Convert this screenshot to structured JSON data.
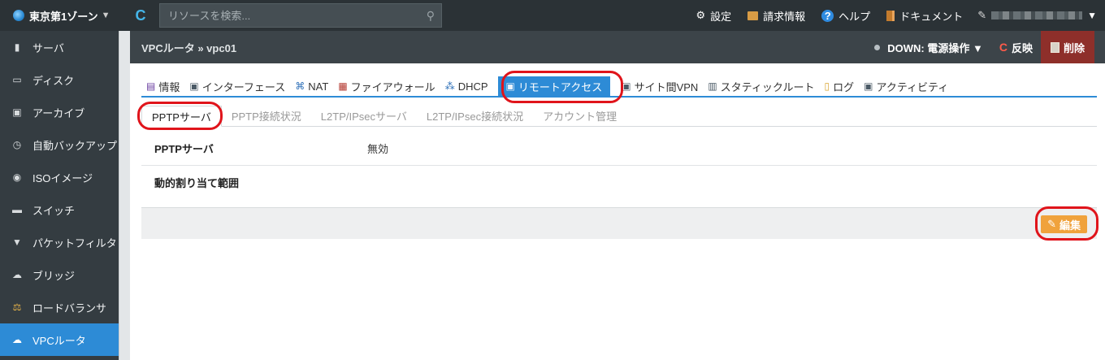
{
  "topbar": {
    "zone_label": "東京第1ゾーン",
    "search_placeholder": "リソースを検索...",
    "links": [
      {
        "label": "設定",
        "icon": "gear-icon"
      },
      {
        "label": "請求情報",
        "icon": "billing-icon"
      },
      {
        "label": "ヘルプ",
        "icon": "help-icon"
      },
      {
        "label": "ドキュメント",
        "icon": "document-icon"
      }
    ]
  },
  "sidebar": {
    "items": [
      {
        "label": "サーバ",
        "icon": "server-icon"
      },
      {
        "label": "ディスク",
        "icon": "disk-icon"
      },
      {
        "label": "アーカイブ",
        "icon": "archive-icon"
      },
      {
        "label": "自動バックアップ",
        "icon": "clock-icon"
      },
      {
        "label": "ISOイメージ",
        "icon": "cd-icon"
      },
      {
        "label": "スイッチ",
        "icon": "switch-icon"
      },
      {
        "label": "パケットフィルタ",
        "icon": "filter-icon"
      },
      {
        "label": "ブリッジ",
        "icon": "bridge-icon"
      },
      {
        "label": "ロードバランサ",
        "icon": "balance-icon"
      },
      {
        "label": "VPCルータ",
        "icon": "router-icon"
      }
    ],
    "active_index": 9
  },
  "header": {
    "breadcrumb": "VPCルータ » vpc01",
    "status": "DOWN: 電源操作 ▼",
    "reflect_label": "反映",
    "delete_label": "削除"
  },
  "tabs": [
    {
      "label": "情報",
      "icon": "info-icon"
    },
    {
      "label": "インターフェース",
      "icon": "interface-icon"
    },
    {
      "label": "NAT",
      "icon": "nat-icon"
    },
    {
      "label": "ファイアウォール",
      "icon": "firewall-icon"
    },
    {
      "label": "DHCP",
      "icon": "dhcp-icon"
    },
    {
      "label": "リモートアクセス",
      "icon": "remote-access-icon"
    },
    {
      "label": "サイト間VPN",
      "icon": "vpn-icon"
    },
    {
      "label": "スタティックルート",
      "icon": "route-icon"
    },
    {
      "label": "ログ",
      "icon": "log-icon"
    },
    {
      "label": "アクティビティ",
      "icon": "activity-icon"
    }
  ],
  "active_tab": 5,
  "subtabs": [
    "PPTPサーバ",
    "PPTP接続状況",
    "L2TP/IPsecサーバ",
    "L2TP/IPsec接続状況",
    "アカウント管理"
  ],
  "active_subtab": 0,
  "details": [
    {
      "label": "PPTPサーバ",
      "value": "無効"
    },
    {
      "label": "動的割り当て範囲",
      "value": ""
    }
  ],
  "edit_label": "編集",
  "colors": {
    "accent": "#2d8bd6",
    "edit": "#f0a23c",
    "highlight": "#e0141b",
    "delete": "#8e2f2a"
  }
}
